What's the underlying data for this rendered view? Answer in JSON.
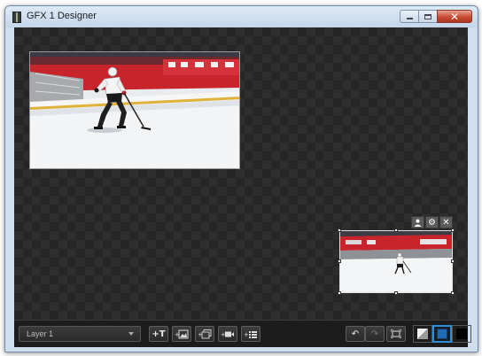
{
  "window": {
    "title": "GFX 1 Designer",
    "controls": [
      "minimize-icon",
      "maximize-icon",
      "close-icon"
    ]
  },
  "canvas": {
    "layers": [
      {
        "name": "main-video-source",
        "content": "hockey player skating on ice rink"
      },
      {
        "name": "pip-video-source",
        "content": "hockey player skating on ice rink",
        "selected": true
      }
    ],
    "selection_tools": [
      "user-icon",
      "gear-icon",
      "close-icon"
    ]
  },
  "toolbar": {
    "layer_select_value": "Layer 1",
    "add_buttons": [
      {
        "icon": "add-text-icon",
        "glyph": "+T"
      },
      {
        "icon": "add-image-icon"
      },
      {
        "icon": "add-slideshow-icon"
      },
      {
        "icon": "add-video-icon"
      },
      {
        "icon": "add-list-icon"
      }
    ],
    "undo_icon": "undo-icon",
    "redo_icon": "redo-icon",
    "fit_icon": "fit-screen-icon",
    "background_modes": [
      {
        "icon": "background-white-icon",
        "color": "#f0f0f0"
      },
      {
        "icon": "background-blue-icon",
        "color": "#1f6cb5",
        "active": true
      },
      {
        "icon": "background-black-icon",
        "color": "#000000"
      }
    ]
  },
  "colors": {
    "canvas_dark": "#262626",
    "canvas_check": "#2e2e2e",
    "accent_blue": "#2d8fd8",
    "arena_red": "#c8242b"
  }
}
